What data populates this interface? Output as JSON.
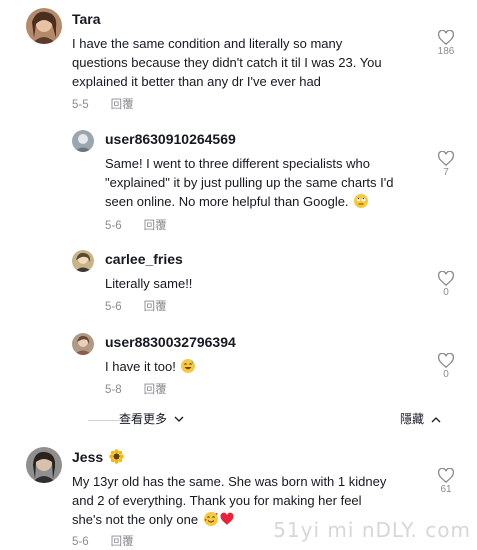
{
  "colors": {
    "text": "#161823",
    "meta": "#8a8b91",
    "heart_outline": "#8a8b91",
    "heart_red": "#e8223a"
  },
  "comments": [
    {
      "user": "Tara",
      "text_lines": [
        "I have the same condition and literally so many",
        "questions because they didn't catch it til I was 23. You",
        "explained it better than any dr I've ever had"
      ],
      "date": "5-5",
      "reply": "回覆",
      "likes": "186"
    },
    {
      "user": "user8630910264569",
      "text_lines": [
        "Same! I went to three different specialists who",
        "\"explained\" it by just pulling up the same charts I'd",
        "seen online. No more helpful than Google."
      ],
      "emoji_icon": "face-with-rolling-eyes-icon",
      "date": "5-6",
      "reply": "回覆",
      "likes": "7"
    },
    {
      "user": "carlee_fries",
      "text_lines": [
        "Literally same!!"
      ],
      "date": "5-6",
      "reply": "回覆",
      "likes": "0"
    },
    {
      "user": "user8830032796394",
      "text_lines": [
        "I have it too!"
      ],
      "emoji_icon": "grinning-sweat-face-icon",
      "date": "5-8",
      "reply": "回覆",
      "likes": "0"
    },
    {
      "user": "Jess",
      "user_emoji_icon": "sunflower-icon",
      "text_lines": [
        "My 13yr old has the same. She was born with 1 kidney",
        "and 2 of everything. Thank you for making her feel",
        "she's not the only one"
      ],
      "emoji_icons": [
        "smiling-face-with-hearts-icon",
        "red-heart-icon"
      ],
      "date": "5-6",
      "reply": "回覆",
      "likes": "61"
    }
  ],
  "thread_controls": {
    "view_more": "查看更多",
    "hide": "隱藏"
  },
  "watermark": "51yi mi nDLY. com"
}
